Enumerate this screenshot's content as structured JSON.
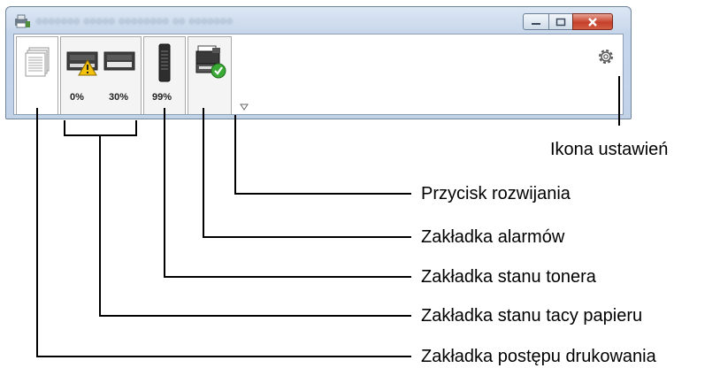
{
  "window": {
    "title": "ooooooo ooooo oooooooo oo ooooooo"
  },
  "tabs": {
    "paper_tray": {
      "percent_1": "0%",
      "percent_2": "30%"
    },
    "toner": {
      "percent": "99%"
    }
  },
  "callouts": {
    "settings_icon": "Ikona ustawień",
    "expand_button": "Przycisk rozwijania",
    "alarm_tab": "Zakładka alarmów",
    "toner_tab": "Zakładka stanu tonera",
    "paper_tray_tab": "Zakładka stanu tacy papieru",
    "print_progress_tab": "Zakładka postępu drukowania"
  },
  "colors": {
    "close_button": "#c6402a",
    "warning": "#f4c20d",
    "ok_badge": "#3aa935"
  }
}
